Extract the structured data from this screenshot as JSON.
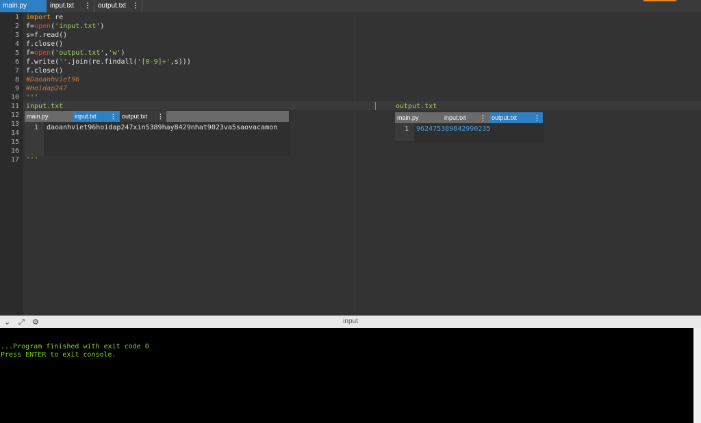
{
  "tabs": [
    {
      "label": "main.py",
      "active": true
    },
    {
      "label": "input.txt",
      "active": false
    },
    {
      "label": "output.txt",
      "active": false
    }
  ],
  "menu_glyph": "⋮",
  "editor": {
    "line_numbers": [
      "1",
      "2",
      "3",
      "4",
      "5",
      "6",
      "7",
      "8",
      "9",
      "10",
      "11",
      "12",
      "13",
      "14",
      "15",
      "16",
      "17"
    ],
    "lines": {
      "l1_kw": "import",
      "l1_rest": " re",
      "l2_a": "f=",
      "l2_fn": "open",
      "l2_b": "(",
      "l2_str": "'input.txt'",
      "l2_c": ")",
      "l3": "s=f.read()",
      "l4": "f.close()",
      "l5_a": "f=",
      "l5_fn": "open",
      "l5_b": "(",
      "l5_s1": "'output.txt'",
      "l5_c": ",",
      "l5_s2": "'w'",
      "l5_d": ")",
      "l6_a": "f.write(",
      "l6_s1": "''",
      "l6_b": ".join(re.findall(",
      "l6_s2": "'[0-9]+'",
      "l6_c": ",s)))",
      "l7": "f.close()",
      "l8": "#Daoanhviet96",
      "l9": "#Hoidap247",
      "l10": "'''",
      "l11_left": "input.txt",
      "l11_right": "output.txt",
      "l17": "'''"
    }
  },
  "input_window": {
    "tabs": [
      {
        "label": "main.py"
      },
      {
        "label": "input.txt"
      },
      {
        "label": "output.txt"
      }
    ],
    "line_number": "1",
    "content": "daoanhviet96hoidap247xin5389hay8429nhat9023va5saovacamon"
  },
  "output_window": {
    "tabs": [
      {
        "label": "main.py"
      },
      {
        "label": "input.txt"
      },
      {
        "label": "output.txt"
      }
    ],
    "line_number": "1",
    "content": "962475389842990235"
  },
  "console": {
    "title": "input",
    "lines": [
      "...Program finished with exit code 0",
      "Press ENTER to exit console."
    ]
  },
  "icons": {
    "collapse": "⌄",
    "expand": "⤢",
    "settings": "⚙"
  }
}
